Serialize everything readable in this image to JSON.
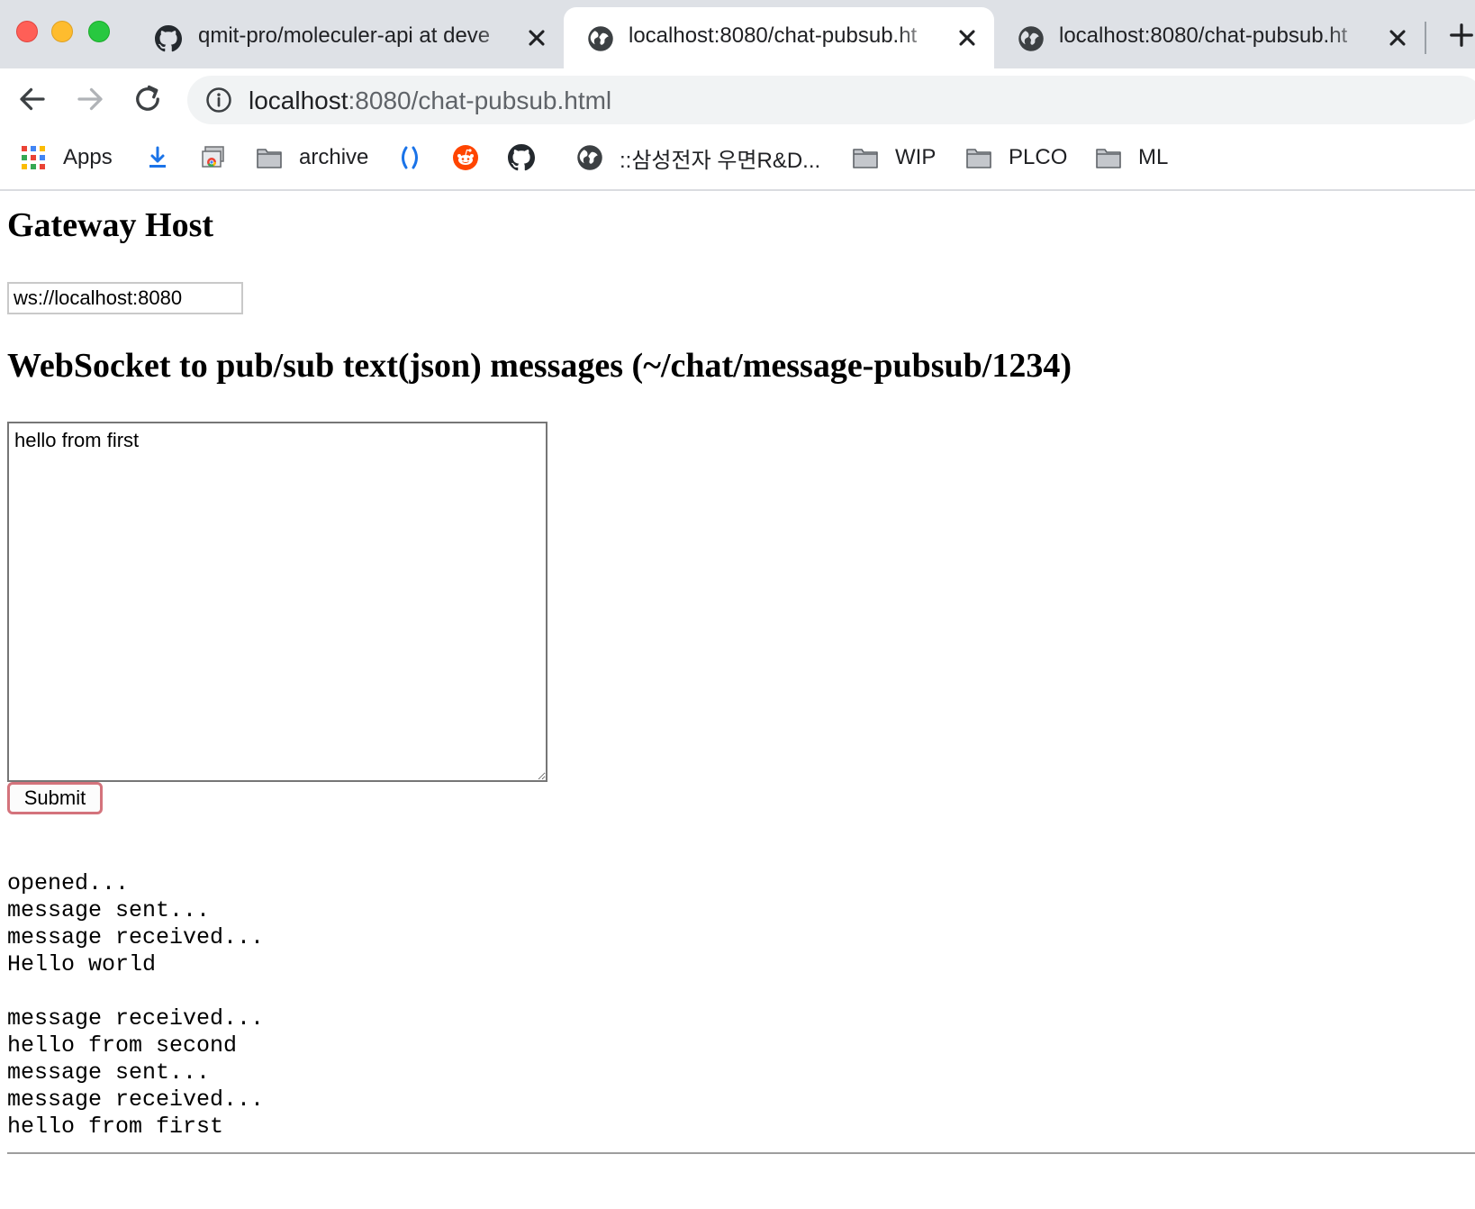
{
  "window": {
    "traffic_lights": [
      "close",
      "minimize",
      "zoom"
    ]
  },
  "tabs": [
    {
      "title": "qmit-pro/moleculer-api at deve",
      "icon": "github-icon",
      "active": false
    },
    {
      "title": "localhost:8080/chat-pubsub.ht",
      "icon": "globe-icon",
      "active": true
    },
    {
      "title": "localhost:8080/chat-pubsub.ht",
      "icon": "globe-icon",
      "active": false
    }
  ],
  "address_bar": {
    "host": "localhost",
    "path": ":8080/chat-pubsub.html"
  },
  "bookmarks": [
    {
      "label": "Apps",
      "icon": "apps-grid-icon"
    },
    {
      "label": "",
      "icon": "download-icon"
    },
    {
      "label": "",
      "icon": "chrome-window-icon"
    },
    {
      "label": "archive",
      "icon": "folder-icon"
    },
    {
      "label": "",
      "icon": "parentheses-icon"
    },
    {
      "label": "",
      "icon": "reddit-icon"
    },
    {
      "label": "",
      "icon": "github-icon"
    },
    {
      "label": "::삼성전자 우면R&D...",
      "icon": "globe-icon"
    },
    {
      "label": "WIP",
      "icon": "folder-icon"
    },
    {
      "label": "PLCO",
      "icon": "folder-icon"
    },
    {
      "label": "ML",
      "icon": "folder-icon"
    }
  ],
  "page": {
    "gateway_heading": "Gateway Host",
    "gateway_host_value": "ws://localhost:8080",
    "ws_heading": "WebSocket to pub/sub text(json) messages (~/chat/message-pubsub/1234)",
    "message_value": "hello from first",
    "submit_label": "Submit",
    "log_lines": [
      "opened...",
      "message sent...",
      "message received...",
      "Hello world",
      "",
      "message received...",
      "hello from second",
      "message sent...",
      "message received...",
      "hello from first"
    ]
  }
}
